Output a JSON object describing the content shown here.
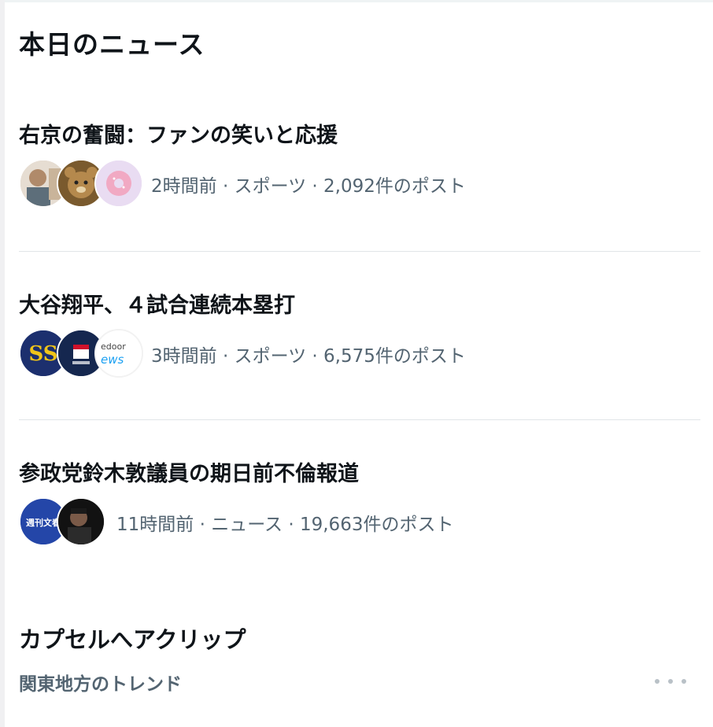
{
  "section": {
    "title": "本日のニュース"
  },
  "news": [
    {
      "headline": "右京の奮闘：ファンの笑いと応援",
      "meta": "2時間前 · スポーツ · 2,092件のポスト",
      "avatars": [
        {
          "name": "user-photo-avatar",
          "color": "#c9b49a"
        },
        {
          "name": "bear-avatar",
          "color": "#8a6a3a"
        },
        {
          "name": "donut-avatar",
          "color": "#e4d4ef"
        }
      ]
    },
    {
      "headline": "大谷翔平、４試合連続本塁打",
      "meta": "3時間前 · スポーツ · 6,575件のポスト",
      "avatars": [
        {
          "name": "team-logo-avatar",
          "color": "#1c2f6e",
          "text": "SS"
        },
        {
          "name": "samurai-japan-avatar",
          "color": "#15274f"
        },
        {
          "name": "livedoor-news-avatar",
          "color": "#ffffff",
          "text": "edoor",
          "text2": "ews"
        }
      ]
    },
    {
      "headline": "参政党鈴木敦議員の期日前不倫報道",
      "meta": "11時間前 · ニュース · 19,663件のポスト",
      "avatars": [
        {
          "name": "shukan-bunshun-avatar",
          "color": "#2446a8",
          "text": "週刊文春"
        },
        {
          "name": "person-photo-avatar",
          "color": "#1a1a1a"
        }
      ]
    }
  ],
  "capsule": {
    "title": "カプセルへアクリップ"
  },
  "trend": {
    "category": "関東地方のトレンド"
  }
}
